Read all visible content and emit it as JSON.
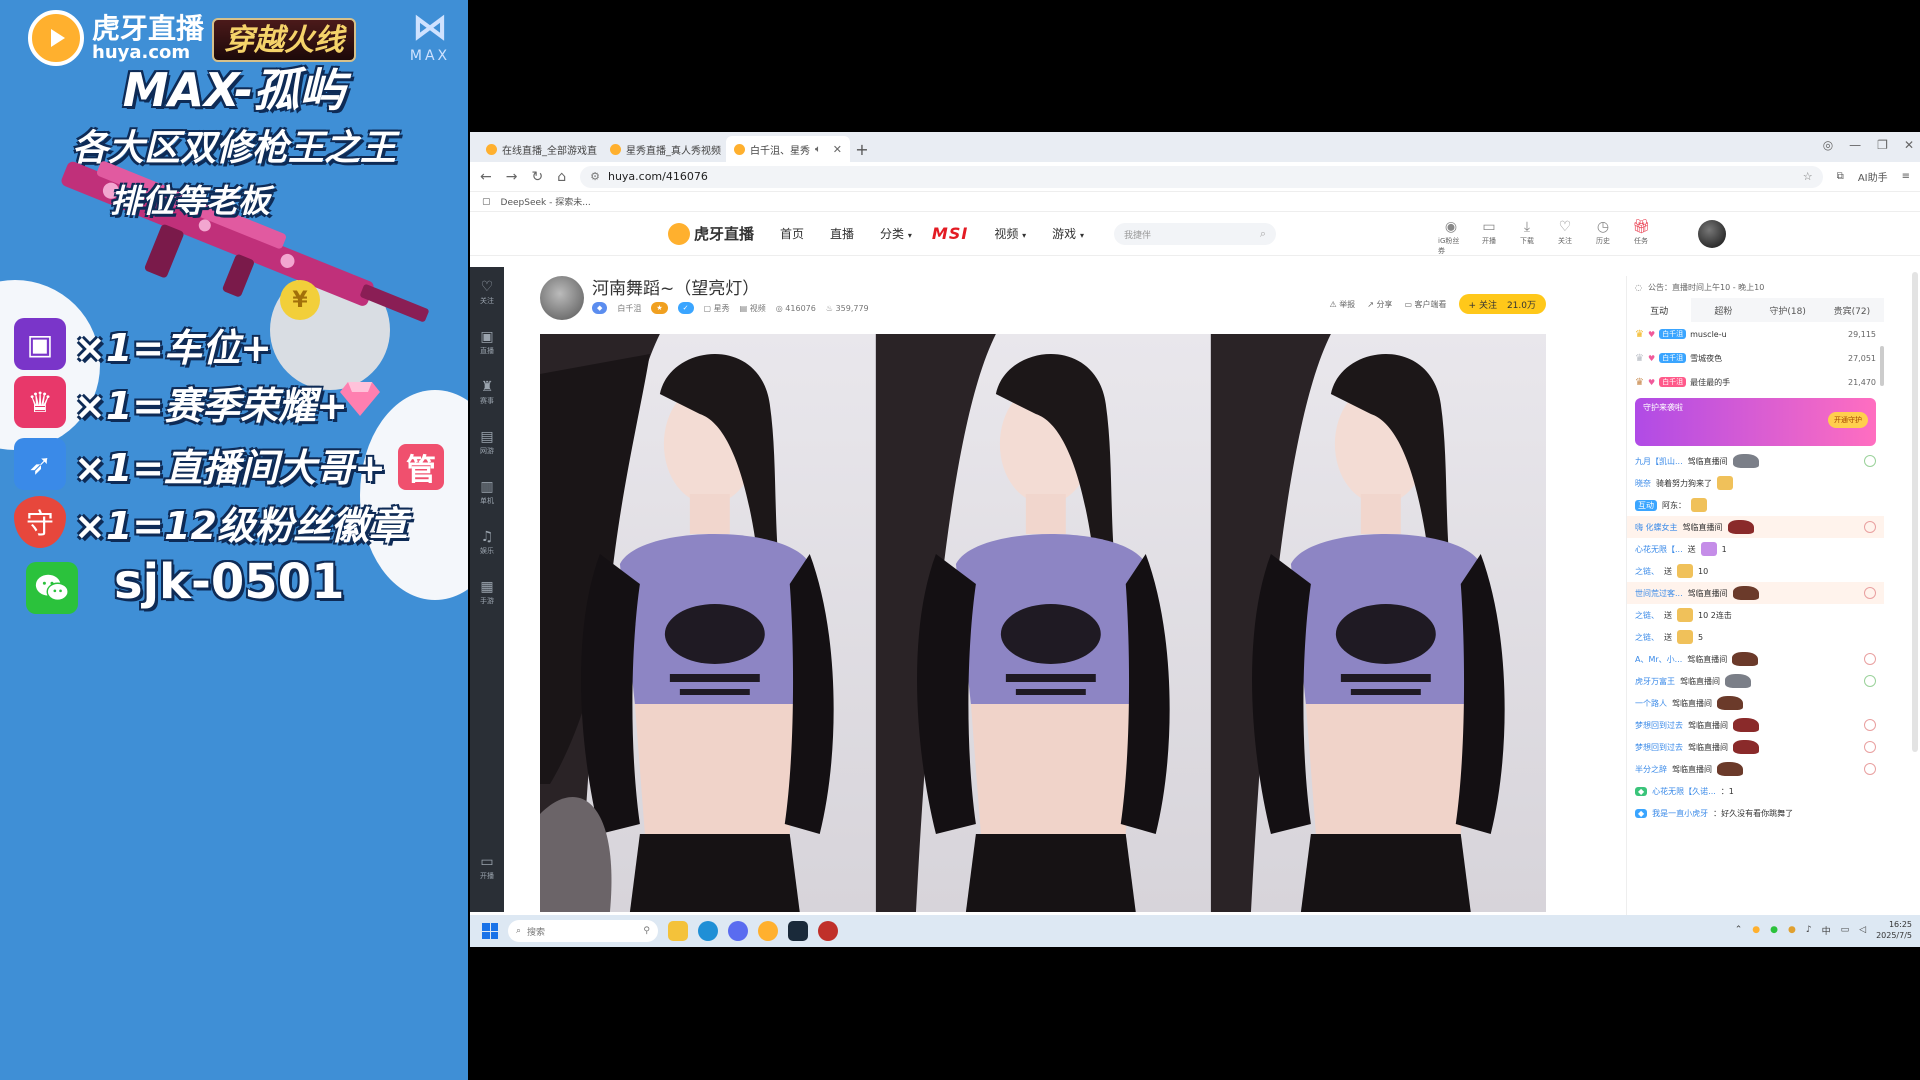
{
  "overlay": {
    "huya_name": "虎牙直播",
    "huya_domain": "huya.com",
    "cf_logo": "穿越火线",
    "max_logo": "MAX",
    "title": "MAX-孤屿",
    "subtitle": "各大区双修枪王之王",
    "tagline": "排位等老板",
    "rewards": [
      {
        "text": "×1=车位+"
      },
      {
        "text": "×1=赛季荣耀+"
      },
      {
        "text": "×1=直播间大哥+"
      },
      {
        "text": "×1=12级粉丝徽章"
      }
    ],
    "manager_badge": "管",
    "wechat_id": "sjk-0501"
  },
  "browser": {
    "tabs": [
      {
        "label": "在线直播_全部游戏直"
      },
      {
        "label": "星秀直播_真人秀视频"
      },
      {
        "label": "白千沮、星秀"
      }
    ],
    "url": "huya.com/416076",
    "bookmark": "DeepSeek - 探索未...",
    "ai_label": "AI助手"
  },
  "site": {
    "logo": "虎牙直播",
    "nav": [
      "首页",
      "直播",
      "分类",
      "视频",
      "游戏"
    ],
    "msi": "MSI",
    "search_placeholder": "我捷伴",
    "header_icons": [
      {
        "icon": "ai-icon",
        "label": "iG粉丝券"
      },
      {
        "icon": "broadcast-icon",
        "label": "开播"
      },
      {
        "icon": "download-icon",
        "label": "下载"
      },
      {
        "icon": "heart-icon",
        "label": "关注"
      },
      {
        "icon": "clock-icon",
        "label": "历史"
      },
      {
        "icon": "gift-icon",
        "label": "任务"
      }
    ],
    "rail": [
      {
        "icon": "heart-icon",
        "label": "关注"
      },
      {
        "icon": "live-icon",
        "label": "直播"
      },
      {
        "icon": "trophy-icon",
        "label": "赛事"
      },
      {
        "icon": "game-icon",
        "label": "网游"
      },
      {
        "icon": "phone-icon",
        "label": "单机"
      },
      {
        "icon": "music-icon",
        "label": "娱乐"
      },
      {
        "icon": "mobile-icon",
        "label": "手游"
      }
    ],
    "rail_bottom": {
      "icon": "broadcast-icon",
      "label": "开播"
    }
  },
  "room": {
    "title": "河南舞蹈~（望亮灯）",
    "streamer": "白千沮",
    "category": "星秀",
    "video_label": "视频",
    "room_id": "416076",
    "heat": "359,779",
    "actions": [
      "举报",
      "分享",
      "客户端看"
    ],
    "follow_label": "+ 关注",
    "follower_count": "21.0万"
  },
  "chat": {
    "notice": "公告：直播时间上午10 - 晚上10",
    "tabs": [
      "互动",
      "超粉",
      "守护(18)",
      "贵宾(72)"
    ],
    "ranking": [
      {
        "tag": "白千沮",
        "name": "muscle-u",
        "value": "29,115"
      },
      {
        "tag": "白千沮",
        "name": "雪城夜色",
        "value": "27,051"
      },
      {
        "tag": "白千沮",
        "name": "最佳最的手",
        "value": "21,470"
      }
    ],
    "guard_title": "守护来袭啦",
    "guard_btn": "开通守护",
    "messages": [
      {
        "user": "九月【凯山...",
        "text": "驾临直播间"
      },
      {
        "user": "晓奈",
        "text": "骑着努力狗来了"
      },
      {
        "user": "互动",
        "text": "阿东："
      },
      {
        "user": "嗨 化蝶女主",
        "text": "驾临直播间"
      },
      {
        "user": "心花无限【...",
        "text": "送",
        "count": "1"
      },
      {
        "user": "之链、",
        "text": "送",
        "count": "10"
      },
      {
        "user": "世间荒过客...",
        "text": "驾临直播间"
      },
      {
        "user": "之链、",
        "text": "送",
        "count": "10 2连击"
      },
      {
        "user": "之链、",
        "text": "送",
        "count": "5"
      },
      {
        "user": "A、Mr、小...",
        "text": "驾临直播间"
      },
      {
        "user": "虎牙万富王",
        "text": "驾临直播间"
      },
      {
        "user": "一个路人",
        "text": "驾临直播间"
      },
      {
        "user": "梦想回到过去",
        "text": "驾临直播间"
      },
      {
        "user": "梦想回到过去",
        "text": "驾临直播间"
      },
      {
        "user": "半分之辞",
        "text": "驾临直播间"
      },
      {
        "user": "心花无限【久诺...",
        "text": "：1"
      },
      {
        "user": "我是一直小虎牙",
        "text": "：好久没有看你跳舞了"
      }
    ]
  },
  "taskbar": {
    "search_placeholder": "搜索",
    "ime": "中",
    "time": "16:25",
    "date": "2025/7/5"
  },
  "colors": {
    "overlay_bg": "#3f8fd6",
    "huya_orange": "#ffb02e",
    "follow_yellow": "#ffc81a",
    "msi_red": "#e31b23"
  }
}
